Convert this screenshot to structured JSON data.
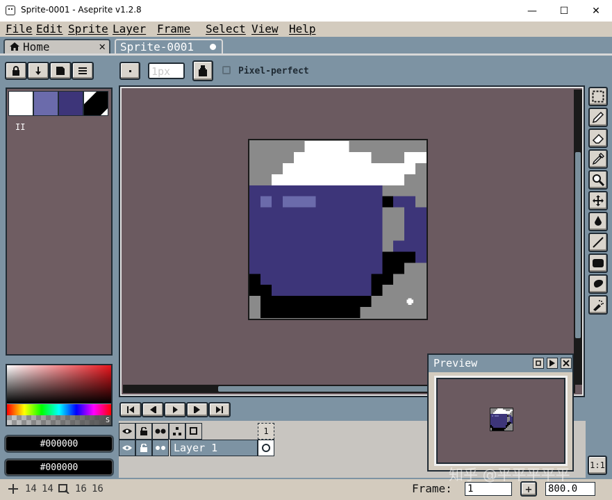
{
  "window": {
    "title": "Sprite-0001 - Aseprite v1.2.8",
    "minimize": "—",
    "maximize": "☐",
    "close": "✕"
  },
  "menu": [
    "File",
    "Edit",
    "Sprite",
    "Layer",
    "Frame",
    "Select",
    "View",
    "Help"
  ],
  "tabs": {
    "home": "Home",
    "home_close": "✕",
    "sprite": "Sprite-0001"
  },
  "context": {
    "brush_size_placeholder": "1px",
    "pixel_perfect_label": "Pixel-perfect"
  },
  "palette": {
    "colors": [
      "#ffffff",
      "#6b6bab",
      "#3d3579",
      "#000000"
    ],
    "count_label": "II"
  },
  "colors": {
    "foreground_hex": "#000000",
    "background_hex": "#000000",
    "alpha_label": "S"
  },
  "timeline": {
    "frame_number": "1",
    "layer_name": "Layer 1"
  },
  "preview": {
    "title": "Preview"
  },
  "status": {
    "pos_x": "14",
    "pos_y": "14",
    "size_w": "16",
    "size_h": "16",
    "frame_label": "Frame:",
    "frame_value": "1",
    "zoom_value": "800.0",
    "zoom_button": "+",
    "one_to_one": "1:1"
  },
  "sprite_colors": {
    "gray": "#8a8a8a",
    "white": "#ffffff",
    "navy": "#3d3579",
    "light_navy": "#6b6bab",
    "black": "#000000"
  },
  "watermark": "知乎 @平平平平平"
}
